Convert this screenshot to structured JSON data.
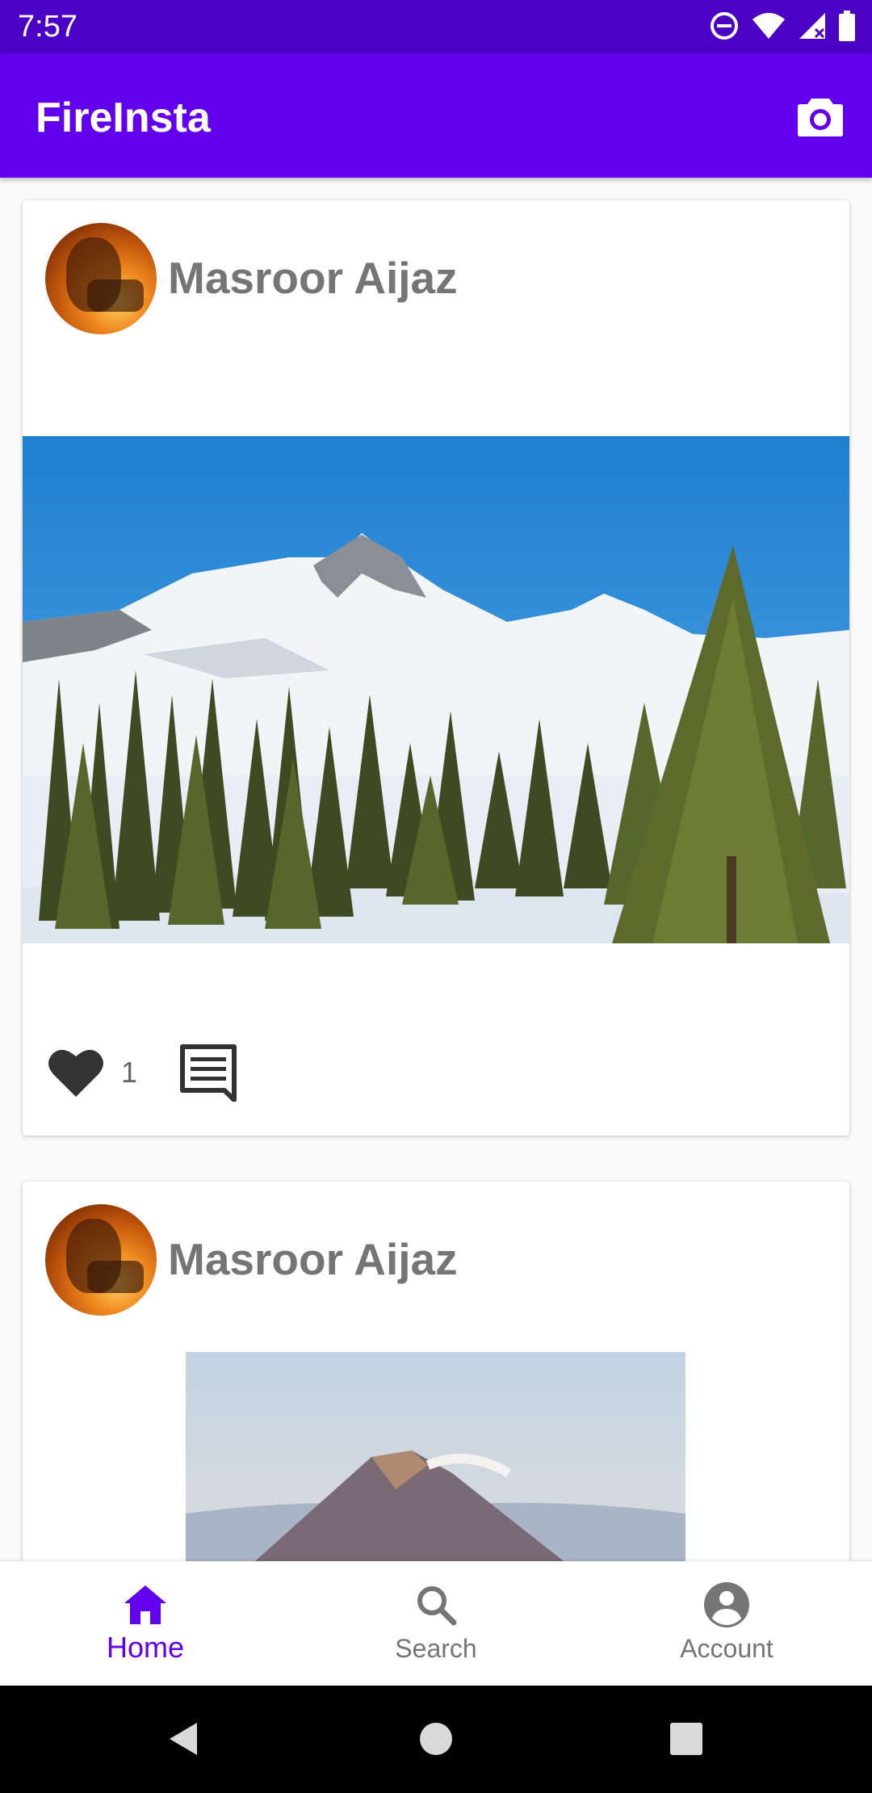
{
  "status_bar": {
    "time": "7:57"
  },
  "app_bar": {
    "title": "FireInsta"
  },
  "posts": [
    {
      "author": "Masroor Aijaz",
      "like_count": "1"
    },
    {
      "author": "Masroor Aijaz"
    }
  ],
  "bottom_nav": {
    "home": "Home",
    "search": "Search",
    "account": "Account"
  },
  "colors": {
    "primary": "#6200ee",
    "primary_dark": "#4b02c4",
    "icon_dark": "#333333",
    "text_muted": "#757575"
  }
}
